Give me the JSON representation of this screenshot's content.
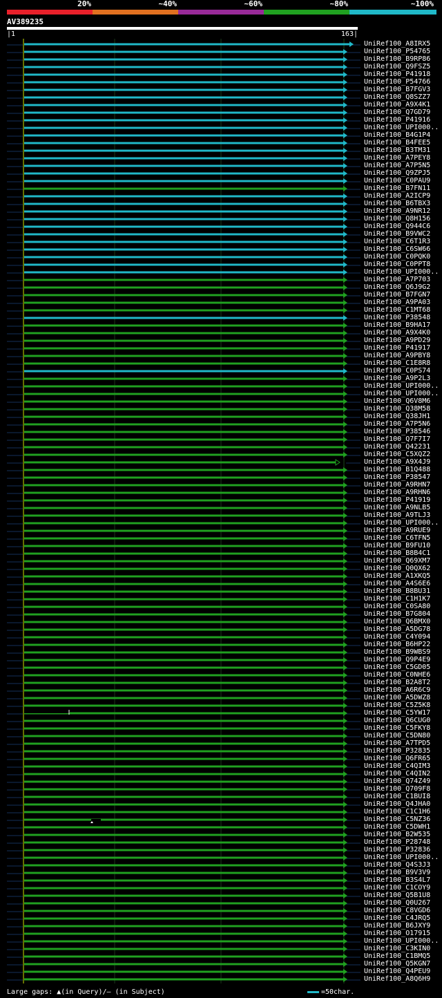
{
  "legend": [
    {
      "label": "20%",
      "color": "#e8202a"
    },
    {
      "label": "~40%",
      "color": "#e07020"
    },
    {
      "label": "~60%",
      "color": "#982a98"
    },
    {
      "label": "~80%",
      "color": "#20a020"
    },
    {
      "label": "~100%",
      "color": "#20b8c8"
    }
  ],
  "query": {
    "id": "AV389235",
    "start": "1",
    "end": "163"
  },
  "footer": {
    "gaps_text": "Large gaps: ▲(in Query)/— (in Subject)",
    "scale_text": "=50char."
  },
  "colors": {
    "cyan": "#20b8c8",
    "green": "#20a020",
    "grid": "#1a3a1a",
    "tick": "#15305a"
  },
  "chart_data": {
    "type": "alignment",
    "query_length": 163,
    "hits": [
      {
        "name": "UniRef100_A8IRX5",
        "color": "cyan",
        "long": true
      },
      {
        "name": "UniRef100_P54765",
        "color": "cyan"
      },
      {
        "name": "UniRef100_B9RP86",
        "color": "cyan"
      },
      {
        "name": "UniRef100_Q9FSZ5",
        "color": "cyan"
      },
      {
        "name": "UniRef100_P41918",
        "color": "cyan"
      },
      {
        "name": "UniRef100_P54766",
        "color": "cyan"
      },
      {
        "name": "UniRef100_B7FGV3",
        "color": "cyan"
      },
      {
        "name": "UniRef100_Q8SZZ7",
        "color": "cyan"
      },
      {
        "name": "UniRef100_A9X4K1",
        "color": "cyan"
      },
      {
        "name": "UniRef100_Q7GD79",
        "color": "cyan"
      },
      {
        "name": "UniRef100_P41916",
        "color": "cyan"
      },
      {
        "name": "UniRef100_UPI000..",
        "color": "cyan"
      },
      {
        "name": "UniRef100_B4G1P4",
        "color": "cyan"
      },
      {
        "name": "UniRef100_B4FEE5",
        "color": "cyan"
      },
      {
        "name": "UniRef100_B3TM31",
        "color": "cyan"
      },
      {
        "name": "UniRef100_A7PEY8",
        "color": "cyan"
      },
      {
        "name": "UniRef100_A7P5N5",
        "color": "cyan"
      },
      {
        "name": "UniRef100_Q9ZPJ5",
        "color": "cyan"
      },
      {
        "name": "UniRef100_C0PAU9",
        "color": "cyan"
      },
      {
        "name": "UniRef100_B7FN11",
        "color": "green"
      },
      {
        "name": "UniRef100_A2ICP9",
        "color": "cyan"
      },
      {
        "name": "UniRef100_B6TBX3",
        "color": "cyan"
      },
      {
        "name": "UniRef100_A9NR12",
        "color": "cyan"
      },
      {
        "name": "UniRef100_Q8H156",
        "color": "cyan"
      },
      {
        "name": "UniRef100_Q944C6",
        "color": "cyan"
      },
      {
        "name": "UniRef100_B9VWC2",
        "color": "cyan"
      },
      {
        "name": "UniRef100_C6T1R3",
        "color": "cyan"
      },
      {
        "name": "UniRef100_C6SW66",
        "color": "cyan"
      },
      {
        "name": "UniRef100_C0PQK0",
        "color": "cyan"
      },
      {
        "name": "UniRef100_C0PPT8",
        "color": "cyan"
      },
      {
        "name": "UniRef100_UPI000..",
        "color": "cyan"
      },
      {
        "name": "UniRef100_A7P703",
        "color": "green"
      },
      {
        "name": "UniRef100_Q6J9G2",
        "color": "green"
      },
      {
        "name": "UniRef100_B7FGN7",
        "color": "green"
      },
      {
        "name": "UniRef100_A9PA03",
        "color": "green"
      },
      {
        "name": "UniRef100_C1MT68",
        "color": "green"
      },
      {
        "name": "UniRef100_P38548",
        "color": "cyan"
      },
      {
        "name": "UniRef100_B9HA17",
        "color": "green"
      },
      {
        "name": "UniRef100_A9X4K0",
        "color": "green"
      },
      {
        "name": "UniRef100_A9PD29",
        "color": "green"
      },
      {
        "name": "UniRef100_P41917",
        "color": "green"
      },
      {
        "name": "UniRef100_A9PBY8",
        "color": "green"
      },
      {
        "name": "UniRef100_C1E8R8",
        "color": "green"
      },
      {
        "name": "UniRef100_C0PS74",
        "color": "cyan"
      },
      {
        "name": "UniRef100_A9P2L3",
        "color": "green"
      },
      {
        "name": "UniRef100_UPI000..",
        "color": "green"
      },
      {
        "name": "UniRef100_UPI000..",
        "color": "green"
      },
      {
        "name": "UniRef100_Q6V8M6",
        "color": "green"
      },
      {
        "name": "UniRef100_Q38M58",
        "color": "green"
      },
      {
        "name": "UniRef100_Q38JH1",
        "color": "green"
      },
      {
        "name": "UniRef100_A7P5N6",
        "color": "green"
      },
      {
        "name": "UniRef100_P38546",
        "color": "green"
      },
      {
        "name": "UniRef100_Q7F7I7",
        "color": "green"
      },
      {
        "name": "UniRef100_Q42231",
        "color": "green"
      },
      {
        "name": "UniRef100_C5XQZ2",
        "color": "green"
      },
      {
        "name": "UniRef100_A9X4J9",
        "color": "green",
        "short": true
      },
      {
        "name": "UniRef100_B1Q488",
        "color": "green"
      },
      {
        "name": "UniRef100_P38547",
        "color": "green"
      },
      {
        "name": "UniRef100_A9RHN7",
        "color": "green"
      },
      {
        "name": "UniRef100_A9RHN6",
        "color": "green"
      },
      {
        "name": "UniRef100_P41919",
        "color": "green"
      },
      {
        "name": "UniRef100_A9NLB5",
        "color": "green"
      },
      {
        "name": "UniRef100_A9TLJ3",
        "color": "green"
      },
      {
        "name": "UniRef100_UPI000..",
        "color": "green"
      },
      {
        "name": "UniRef100_A9RUE9",
        "color": "green"
      },
      {
        "name": "UniRef100_C6TFN5",
        "color": "green"
      },
      {
        "name": "UniRef100_B9FU10",
        "color": "green"
      },
      {
        "name": "UniRef100_B8B4C1",
        "color": "green"
      },
      {
        "name": "UniRef100_Q69XM7",
        "color": "green"
      },
      {
        "name": "UniRef100_Q0QX62",
        "color": "green"
      },
      {
        "name": "UniRef100_A1XKQ5",
        "color": "green"
      },
      {
        "name": "UniRef100_A4S6E6",
        "color": "green"
      },
      {
        "name": "UniRef100_B8BU31",
        "color": "green"
      },
      {
        "name": "UniRef100_C1H1K7",
        "color": "green"
      },
      {
        "name": "UniRef100_C0SA80",
        "color": "green"
      },
      {
        "name": "UniRef100_B7G804",
        "color": "green"
      },
      {
        "name": "UniRef100_Q6BMX0",
        "color": "green"
      },
      {
        "name": "UniRef100_A5DG78",
        "color": "green"
      },
      {
        "name": "UniRef100_C4Y094",
        "color": "green"
      },
      {
        "name": "UniRef100_B6HP22",
        "color": "green"
      },
      {
        "name": "UniRef100_B9WBS9",
        "color": "green"
      },
      {
        "name": "UniRef100_Q9P4E9",
        "color": "green"
      },
      {
        "name": "UniRef100_C5GD05",
        "color": "green"
      },
      {
        "name": "UniRef100_C0NHE6",
        "color": "green"
      },
      {
        "name": "UniRef100_B2A8T2",
        "color": "green"
      },
      {
        "name": "UniRef100_A6R6C9",
        "color": "green"
      },
      {
        "name": "UniRef100_A5DWZ8",
        "color": "green"
      },
      {
        "name": "UniRef100_C5Z5K8",
        "color": "green"
      },
      {
        "name": "UniRef100_C5YW17",
        "color": "green",
        "gap": "subject"
      },
      {
        "name": "UniRef100_Q6CUG0",
        "color": "green"
      },
      {
        "name": "UniRef100_C5FKY8",
        "color": "green"
      },
      {
        "name": "UniRef100_C5DN80",
        "color": "green"
      },
      {
        "name": "UniRef100_A7TPD5",
        "color": "green"
      },
      {
        "name": "UniRef100_P32835",
        "color": "green"
      },
      {
        "name": "UniRef100_Q6FR65",
        "color": "green"
      },
      {
        "name": "UniRef100_C4QIM3",
        "color": "green"
      },
      {
        "name": "UniRef100_C4QIN2",
        "color": "green"
      },
      {
        "name": "UniRef100_Q74Z49",
        "color": "green"
      },
      {
        "name": "UniRef100_Q709F8",
        "color": "green"
      },
      {
        "name": "UniRef100_C1BUI8",
        "color": "green"
      },
      {
        "name": "UniRef100_Q4JHA0",
        "color": "green"
      },
      {
        "name": "UniRef100_C1C1H6",
        "color": "green"
      },
      {
        "name": "UniRef100_C5NZ36",
        "color": "green",
        "gap": "query"
      },
      {
        "name": "UniRef100_C5DWH1",
        "color": "green"
      },
      {
        "name": "UniRef100_B2W535",
        "color": "green"
      },
      {
        "name": "UniRef100_P28748",
        "color": "green"
      },
      {
        "name": "UniRef100_P32836",
        "color": "green"
      },
      {
        "name": "UniRef100_UPI000..",
        "color": "green"
      },
      {
        "name": "UniRef100_Q4S3J3",
        "color": "green"
      },
      {
        "name": "UniRef100_B9V3V9",
        "color": "green"
      },
      {
        "name": "UniRef100_B3S4L7",
        "color": "green"
      },
      {
        "name": "UniRef100_C1COY9",
        "color": "green"
      },
      {
        "name": "UniRef100_Q5B1U8",
        "color": "green"
      },
      {
        "name": "UniRef100_Q0U267",
        "color": "green"
      },
      {
        "name": "UniRef100_C8VGD6",
        "color": "green"
      },
      {
        "name": "UniRef100_C4JRQ5",
        "color": "green"
      },
      {
        "name": "UniRef100_B6JXY9",
        "color": "green"
      },
      {
        "name": "UniRef100_O17915",
        "color": "green"
      },
      {
        "name": "UniRef100_UPI000..",
        "color": "green"
      },
      {
        "name": "UniRef100_C3KIN0",
        "color": "green"
      },
      {
        "name": "UniRef100_C1BMQ5",
        "color": "green"
      },
      {
        "name": "UniRef100_Q5KGN7",
        "color": "green"
      },
      {
        "name": "UniRef100_Q4PEU9",
        "color": "green"
      },
      {
        "name": "UniRef100_A8Q6H9",
        "color": "green"
      }
    ]
  }
}
